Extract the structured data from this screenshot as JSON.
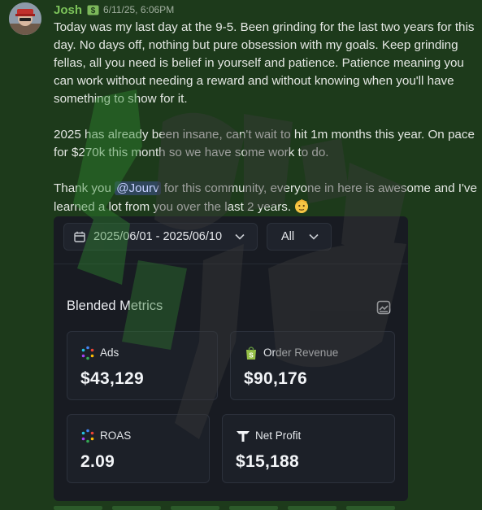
{
  "message": {
    "username": "Josh",
    "timestamp": "6/11/25, 6:06PM",
    "paragraph1": "Today was my last day at the 9-5. Been grinding for the last two years for this day. No days off, nothing but pure obsession with my goals. Keep grinding fellas, all you need is belief in yourself and patience. Patience meaning you can work without needing a reward and without knowing when you'll have something to show for it.",
    "paragraph2": "2025 has already been insane, can't wait to hit 1m months this year. On pace for $270k this month so we have some work to do.",
    "paragraph3_before": "Thank you ",
    "mention": "@Jourv",
    "paragraph3_after": " for this community, everyone in here is awesome and I've learned a lot from you over the last 2 years."
  },
  "dashboard": {
    "date_range": "2025/06/01 - 2025/06/10",
    "filter": "All",
    "section_title": "Blended Metrics",
    "metrics": [
      {
        "label": "Ads",
        "value": "$43,129",
        "icon": "google-ads-dots-icon"
      },
      {
        "label": "Order Revenue",
        "value": "$90,176",
        "icon": "shopify-bag-icon"
      },
      {
        "label": "ROAS",
        "value": "2.09",
        "icon": "roas-dots-icon"
      },
      {
        "label": "Net Profit",
        "value": "$15,188",
        "icon": "triple-whale-icon"
      }
    ]
  },
  "colors": {
    "background": "#1d3a1b",
    "username": "#7cc35a",
    "card": "#181b22",
    "watermark": "#3f3f3f"
  }
}
